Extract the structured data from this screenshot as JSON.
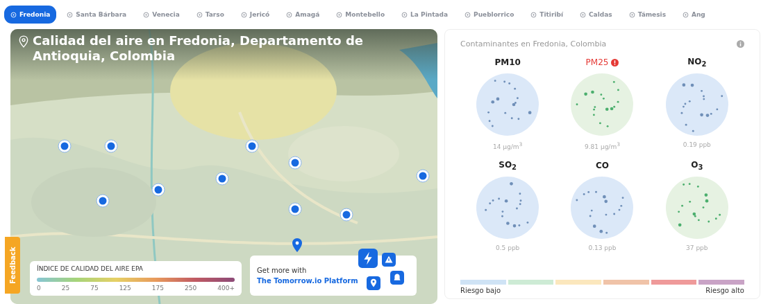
{
  "tabs": [
    {
      "label": "Fredonia",
      "selected": true
    },
    {
      "label": "Santa Bárbara",
      "selected": false
    },
    {
      "label": "Venecia",
      "selected": false
    },
    {
      "label": "Tarso",
      "selected": false
    },
    {
      "label": "Jericó",
      "selected": false
    },
    {
      "label": "Amagá",
      "selected": false
    },
    {
      "label": "Montebello",
      "selected": false
    },
    {
      "label": "La Pintada",
      "selected": false
    },
    {
      "label": "Pueblorrico",
      "selected": false
    },
    {
      "label": "Titiribí",
      "selected": false
    },
    {
      "label": "Caldas",
      "selected": false
    },
    {
      "label": "Támesis",
      "selected": false
    },
    {
      "label": "Ang",
      "selected": false
    }
  ],
  "map": {
    "title": "Calidad del aire en Fredonia, Departamento de Antioquia, Colombia",
    "legend": {
      "title": "ÍNDICE DE CALIDAD DEL AIRE EPA",
      "scale": [
        "0",
        "25",
        "75",
        "125",
        "175",
        "250",
        "400+"
      ]
    },
    "promo": {
      "text": "Get more with",
      "link": "The Tomorrow.io Platform"
    }
  },
  "feedback": "Feedback",
  "pollutants_panel": {
    "title": "Contaminantes en Fredonia, Colombia",
    "pollutants": [
      {
        "name": "PM10",
        "value": "14 µg/m$^{3}$",
        "alert": false,
        "color": "#dbe8f8"
      },
      {
        "name": "PM25",
        "value": "9.81 µg/m$^{3}$",
        "alert": true,
        "color": "#e6f2e2"
      },
      {
        "name": "NO$_{2}$",
        "value": "0.19 ppb",
        "alert": false,
        "color": "#dbe8f8"
      },
      {
        "name": "SO$_{2}$",
        "value": "0.5 ppb",
        "alert": false,
        "color": "#dbe8f8"
      },
      {
        "name": "CO",
        "value": "0.13 ppb",
        "alert": false,
        "color": "#dbe8f8"
      },
      {
        "name": "O$_{3}$",
        "value": "37 ppb",
        "alert": false,
        "color": "#e6f2e2"
      }
    ],
    "risk_scale": [
      {
        "color": "#cfe3f5"
      },
      {
        "color": "#cdebd5"
      },
      {
        "color": "#fbe7bd"
      },
      {
        "color": "#f0c3a8"
      },
      {
        "color": "#ef9a9a"
      },
      {
        "color": "#c9a3c6"
      }
    ],
    "low_label": "Riesgo bajo",
    "high_label": "Riesgo alto"
  }
}
